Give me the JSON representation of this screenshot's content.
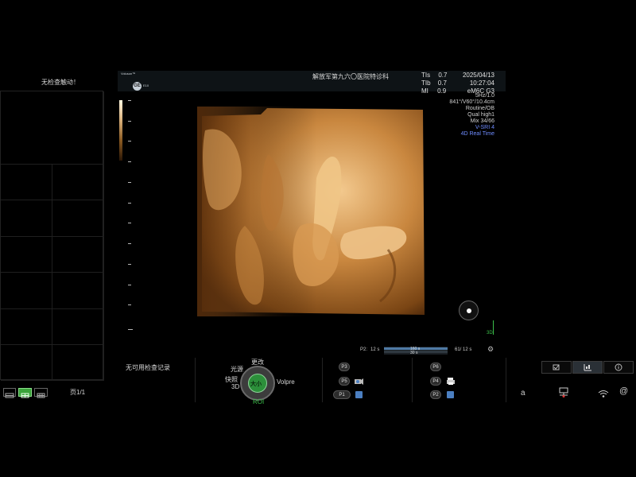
{
  "left_panel": {
    "status_message": "无检查触动！",
    "no_records": "无可用检查记录",
    "page_label": "页1/1"
  },
  "header": {
    "logo_text": "Voluson™",
    "logo_sub": "E10",
    "ge_text": "GE",
    "institution": "解放军第九六〇医院特诊科",
    "tis_label": "TIs",
    "tis_value": "0.7",
    "tib_label": "TIb",
    "tib_value": "0.7",
    "mi_label": "MI",
    "mi_value": "0.9",
    "date": "2025/04/13",
    "time": "10:27:04",
    "probe": "eM6C G3"
  },
  "scan_info": {
    "line1": "5Hz/1.0",
    "line2": "841°/V60°/10.4cm",
    "line3": "Routine/OB",
    "line4": "Qual high1",
    "line5": "Mix 34/66",
    "line6": "V-SRI 4",
    "line7": "4D Real Time"
  },
  "viewport": {
    "label_3d": "3D",
    "accent": "#d89a52"
  },
  "cine": {
    "p2_label": "P2:",
    "left_time": "12 s",
    "bar_top": "160 s",
    "bar_bottom": "30 s",
    "right_frames": "61/ 12 s"
  },
  "controls": {
    "label_top": "更改",
    "label_light": "光源",
    "label_quick": "快照",
    "label_3d": "3D",
    "label_volpre": "Volpre",
    "label_roi": "ROI",
    "knob_label": "大小"
  },
  "buttons_left": {
    "p3": "P3",
    "p5": "P5",
    "p1": "P1"
  },
  "buttons_right": {
    "p6": "P6",
    "p4": "P4",
    "p2": "P2"
  },
  "tray": {
    "a_label": "a",
    "at_label": "@"
  }
}
